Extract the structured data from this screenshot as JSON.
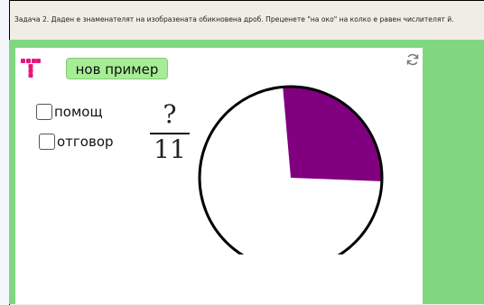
{
  "task": {
    "text": "Задача 2. Даден е знаменателят на изобразената обикновена дроб. Преценете \"на око\" на колко е равен числителят й."
  },
  "applet": {
    "new_example_label": "нов пример",
    "help_label": "помощ",
    "answer_label": "отговор",
    "fraction": {
      "numerator": "?",
      "denominator": "11"
    },
    "pie": {
      "filled_fraction": 0.27,
      "fill_color": "#800080",
      "empty_color": "#ffffff"
    }
  },
  "colors": {
    "side_panel": "#80d780",
    "button_bg": "#a6ed96"
  },
  "icons": {
    "logo": "tiles-logo-icon",
    "refresh": "refresh-icon"
  }
}
